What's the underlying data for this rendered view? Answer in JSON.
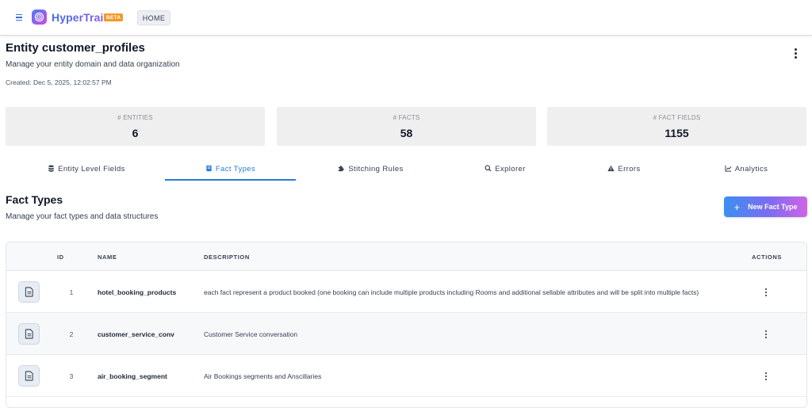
{
  "app": {
    "name": "HyperTrail",
    "badge": "BETA",
    "home_label": "HOME",
    "icons": {
      "menu": "hamburger-menu-icon",
      "logo": "target-logo-icon"
    }
  },
  "header": {
    "title": "Entity customer_profiles",
    "subtitle": "Manage your entity domain and data organization",
    "created": "Created: Dec 5, 2025, 12:02:57 PM"
  },
  "stats": [
    {
      "label": "# ENTITIES",
      "value": "6"
    },
    {
      "label": "# FACTS",
      "value": "58"
    },
    {
      "label": "# FACT FIELDS",
      "value": "1155"
    }
  ],
  "tabs": [
    {
      "label": "Entity Level Fields",
      "icon": "database-icon",
      "active": false
    },
    {
      "label": "Fact Types",
      "icon": "book-icon",
      "active": true
    },
    {
      "label": "Stitching Rules",
      "icon": "puzzle-icon",
      "active": false
    },
    {
      "label": "Explorer",
      "icon": "search-icon",
      "active": false
    },
    {
      "label": "Errors",
      "icon": "warning-icon",
      "active": false
    },
    {
      "label": "Analytics",
      "icon": "line-chart-icon",
      "active": false
    }
  ],
  "section": {
    "title": "Fact Types",
    "subtitle": "Manage your fact types and data structures",
    "new_button": "New Fact Type"
  },
  "table": {
    "columns": {
      "id": "ID",
      "name": "NAME",
      "description": "DESCRIPTION",
      "actions": "ACTIONS"
    },
    "rows": [
      {
        "id": "1",
        "name": "hotel_booking_products",
        "description": "each fact represent a product booked (one booking can include multiple products including Rooms and additional sellable attributes and will be split into multiple facts)"
      },
      {
        "id": "2",
        "name": "customer_service_conv",
        "description": "Customer Service conversation"
      },
      {
        "id": "3",
        "name": "air_booking_segment",
        "description": "Air Bookings segments and Anscillaries"
      }
    ]
  },
  "colors": {
    "accent": "#2b7bd8",
    "brand_gradient_start": "#3f6ee8",
    "brand_gradient_end": "#d24fd4",
    "beta_badge": "#f29a26",
    "stat_bg": "#efefef"
  }
}
